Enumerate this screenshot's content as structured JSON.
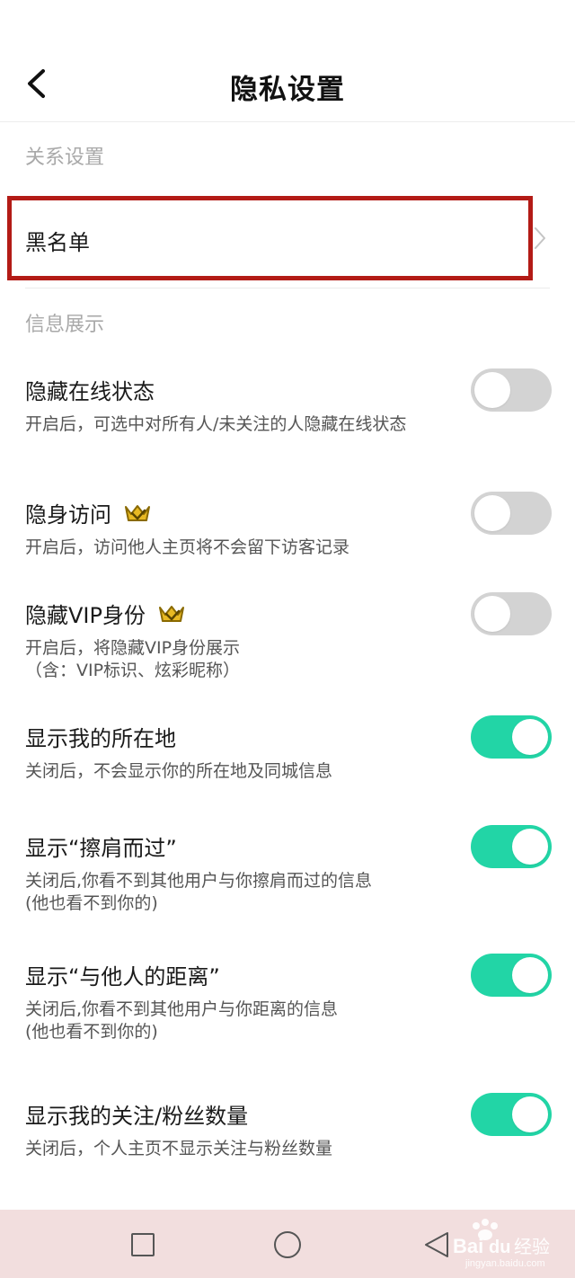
{
  "header": {
    "title": "隐私设置",
    "back_icon": "chevron-left-icon"
  },
  "sections": {
    "relations": {
      "title": "关系设置"
    },
    "info": {
      "title": "信息展示"
    }
  },
  "blacklist": {
    "label": "黑名单",
    "chevron_icon": "chevron-right-icon",
    "highlight_color": "#b31b16"
  },
  "settings": [
    {
      "title": "隐藏在线状态",
      "desc": "开启后，可选中对所有人/未关注的人隐藏在线状态",
      "enabled": false,
      "vip": false
    },
    {
      "title": "隐身访问",
      "desc": "开启后，访问他人主页将不会留下访客记录",
      "enabled": false,
      "vip": true
    },
    {
      "title": "隐藏VIP身份",
      "desc": "开启后，将隐藏VIP身份展示\n（含：VIP标识、炫彩昵称）",
      "enabled": false,
      "vip": true
    },
    {
      "title": "显示我的所在地",
      "desc": "关闭后，不会显示你的所在地及同城信息",
      "enabled": true,
      "vip": false
    },
    {
      "title": "显示“擦肩而过”",
      "desc": "关闭后,你看不到其他用户与你擦肩而过的信息\n(他也看不到你的)",
      "enabled": true,
      "vip": false
    },
    {
      "title": "显示“与他人的距离”",
      "desc": "关闭后,你看不到其他用户与你距离的信息\n(他也看不到你的)",
      "enabled": true,
      "vip": false
    },
    {
      "title": "显示我的关注/粉丝数量",
      "desc": "关闭后，个人主页不显示关注与粉丝数量",
      "enabled": true,
      "vip": false
    }
  ],
  "colors": {
    "toggle_on": "#22d5a6",
    "toggle_off": "#d3d3d3",
    "bottom_bar": "#f2dede"
  },
  "bottom_nav": {
    "icons": [
      "square-icon",
      "circle-icon",
      "triangle-back-icon"
    ]
  },
  "watermark": {
    "logo_text": "Bai",
    "logo_text_cn": "经验",
    "url": "jingyan.baidu.com"
  }
}
